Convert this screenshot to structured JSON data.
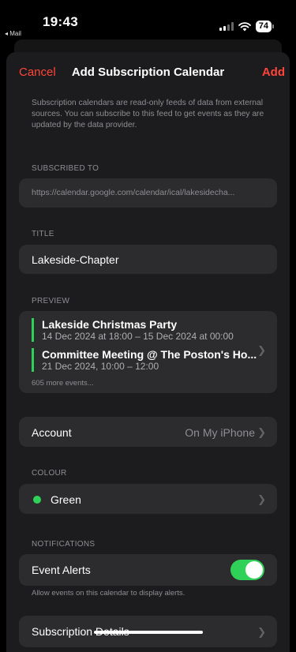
{
  "status": {
    "time": "19:43",
    "back_app": "◂ Mail",
    "battery": "74"
  },
  "nav": {
    "cancel": "Cancel",
    "title": "Add Subscription Calendar",
    "add": "Add"
  },
  "description": "Subscription calendars are read-only feeds of data from external sources. You can subscribe to this feed to get events as they are updated by the data provider.",
  "subscribed": {
    "label": "SUBSCRIBED TO",
    "url": "https://calendar.google.com/calendar/ical/lakesidecha..."
  },
  "title_section": {
    "label": "TITLE",
    "value": "Lakeside-Chapter"
  },
  "preview": {
    "label": "PREVIEW",
    "events": [
      {
        "title": "Lakeside Christmas Party",
        "time": "14 Dec 2024 at 18:00 – 15 Dec 2024 at 00:00"
      },
      {
        "title": "Committee Meeting @ The Poston's Ho...",
        "time": "21 Dec 2024, 10:00 – 12:00"
      }
    ],
    "more": "605 more events..."
  },
  "account": {
    "label": "Account",
    "value": "On My iPhone"
  },
  "colour": {
    "label": "COLOUR",
    "value": "Green",
    "swatch": "#30d158"
  },
  "notifications": {
    "label": "NOTIFICATIONS",
    "event_alerts": "Event Alerts",
    "event_alerts_on": true,
    "hint": "Allow events on this calendar to display alerts."
  },
  "subscription_details": "Subscription Details",
  "colors": {
    "accent": "#ff453a",
    "toggle_on": "#30d158"
  }
}
